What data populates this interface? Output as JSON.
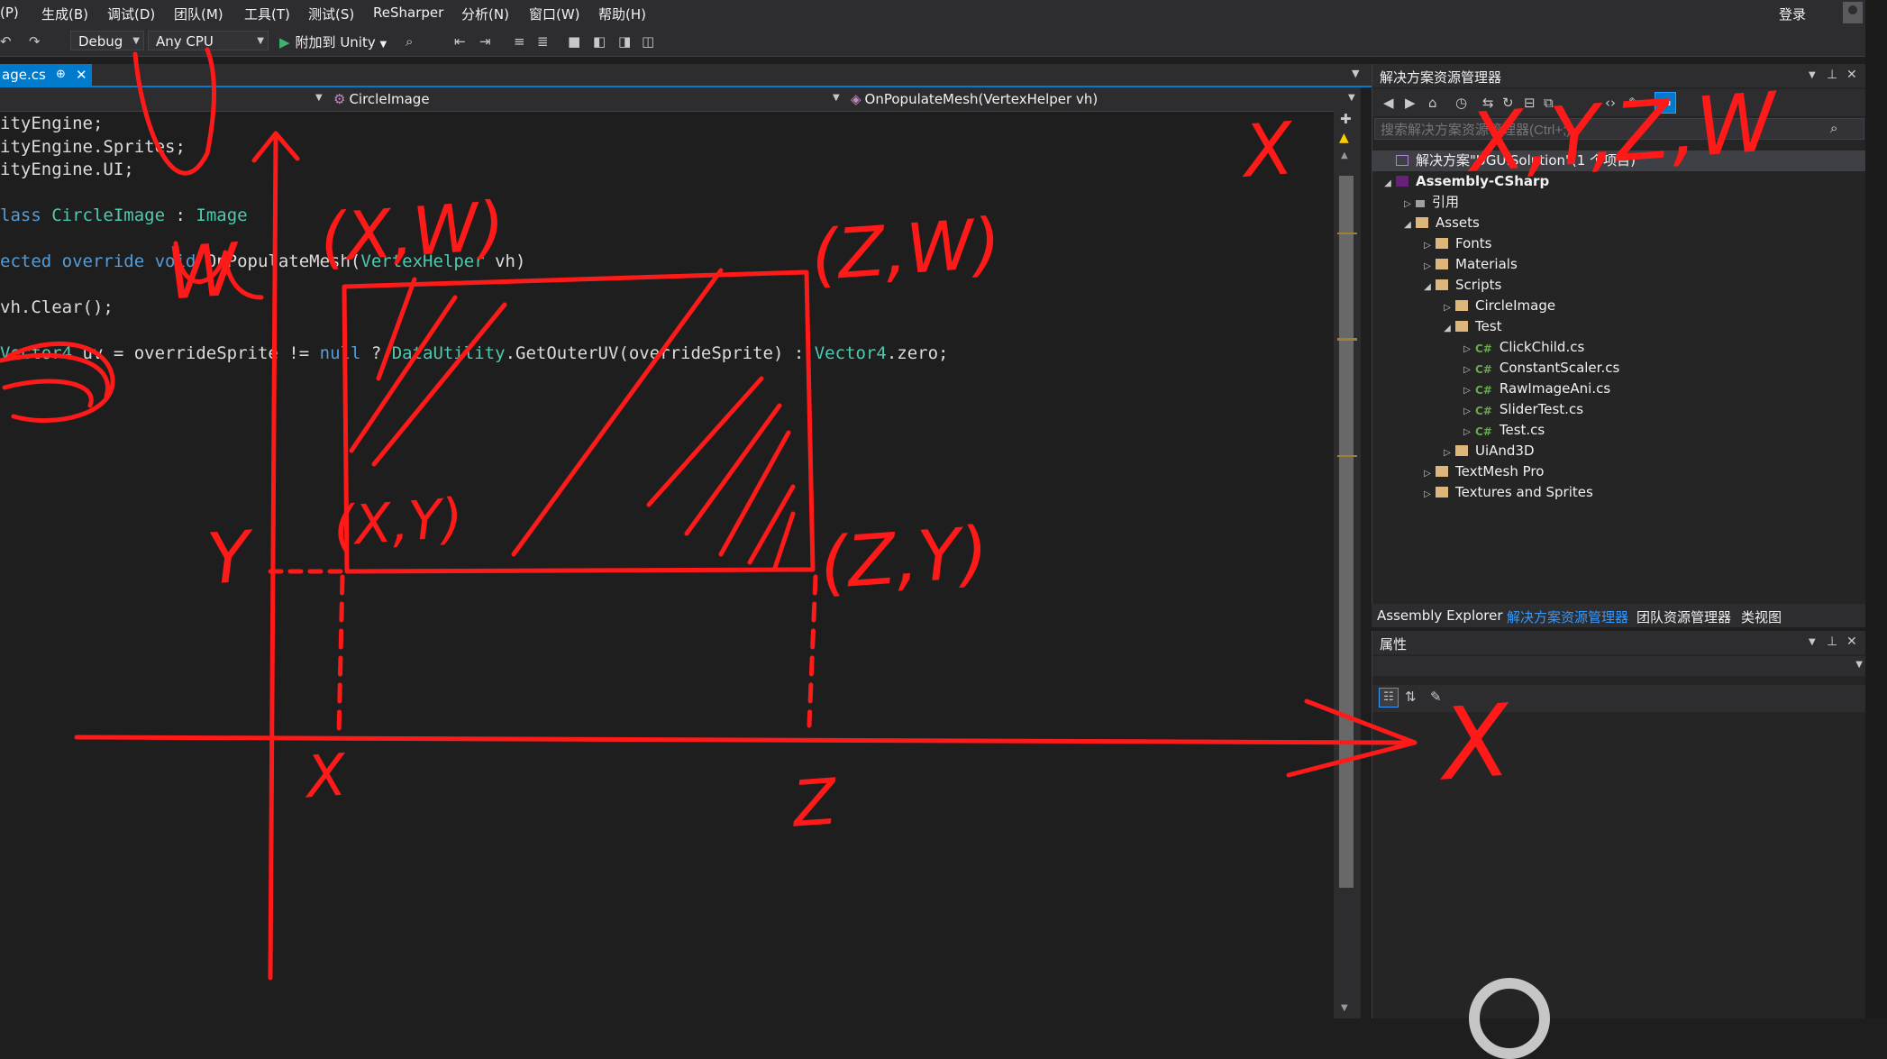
{
  "menu": [
    "(P)",
    "生成(B)",
    "调试(D)",
    "团队(M)",
    "工具(T)",
    "测试(S)",
    "ReSharper",
    "分析(N)",
    "窗口(W)",
    "帮助(H)"
  ],
  "login_label": "登录",
  "toolbar": {
    "config": "Debug",
    "platform": "Any CPU",
    "run_label": "附加到 Unity",
    "icons": [
      "undo-icon",
      "redo-icon",
      "find-icon",
      "comment-icon",
      "bookmark-icon"
    ]
  },
  "editor": {
    "tab_label": "age.cs",
    "tab_pin": "⊕",
    "tab_close": "✕",
    "nav_class": "CircleImage",
    "nav_method": "OnPopulateMesh(VertexHelper vh)"
  },
  "code": {
    "lines": [
      [
        {
          "t": "ityEngine;",
          "c": "tx"
        }
      ],
      [
        {
          "t": "ityEngine.Sprites;",
          "c": "tx"
        }
      ],
      [
        {
          "t": "ityEngine.UI;",
          "c": "tx"
        }
      ],
      [],
      [
        {
          "t": "lass ",
          "c": "kw"
        },
        {
          "t": "CircleImage",
          "c": "ty"
        },
        {
          "t": " : ",
          "c": "tx"
        },
        {
          "t": "Image",
          "c": "ty"
        }
      ],
      [],
      [
        {
          "t": "ected override void ",
          "c": "kw"
        },
        {
          "t": "OnPopulateMesh(",
          "c": "tx"
        },
        {
          "t": "VertexHelper",
          "c": "ty"
        },
        {
          "t": " vh)",
          "c": "tx"
        }
      ],
      [],
      [
        {
          "t": "vh.Clear();",
          "c": "tx"
        }
      ],
      [],
      [
        {
          "t": "Vector4",
          "c": "ty"
        },
        {
          "t": " uv = overrideSprite != ",
          "c": "tx"
        },
        {
          "t": "null",
          "c": "kw"
        },
        {
          "t": " ? ",
          "c": "tx"
        },
        {
          "t": "DataUtility",
          "c": "ty"
        },
        {
          "t": ".GetOuterUV(overrideSprite) : ",
          "c": "tx"
        },
        {
          "t": "Vector4",
          "c": "ty"
        },
        {
          "t": ".zero;",
          "c": "tx"
        }
      ]
    ]
  },
  "solution_explorer": {
    "title": "解决方案资源管理器",
    "search_placeholder": "搜索解决方案资源管理器(Ctrl+;)",
    "tree": [
      {
        "label": "解决方案\"UGUISolution\"(1 个项目)",
        "depth": 0,
        "expander": "",
        "icon": "sol",
        "bold": false
      },
      {
        "label": "Assembly-CSharp",
        "depth": 0,
        "expander": "◢",
        "icon": "proj",
        "bold": true
      },
      {
        "label": "引用",
        "depth": 1,
        "expander": "▷",
        "icon": "ref",
        "bold": false
      },
      {
        "label": "Assets",
        "depth": 1,
        "expander": "◢",
        "icon": "folder",
        "bold": false
      },
      {
        "label": "Fonts",
        "depth": 2,
        "expander": "▷",
        "icon": "folder",
        "bold": false
      },
      {
        "label": "Materials",
        "depth": 2,
        "expander": "▷",
        "icon": "folder",
        "bold": false
      },
      {
        "label": "Scripts",
        "depth": 2,
        "expander": "◢",
        "icon": "folder",
        "bold": false
      },
      {
        "label": "CircleImage",
        "depth": 3,
        "expander": "▷",
        "icon": "folder",
        "bold": false
      },
      {
        "label": "Test",
        "depth": 3,
        "expander": "◢",
        "icon": "folder",
        "bold": false
      },
      {
        "label": "ClickChild.cs",
        "depth": 4,
        "expander": "▷",
        "icon": "cs",
        "bold": false
      },
      {
        "label": "ConstantScaler.cs",
        "depth": 4,
        "expander": "▷",
        "icon": "cs",
        "bold": false
      },
      {
        "label": "RawImageAni.cs",
        "depth": 4,
        "expander": "▷",
        "icon": "cs",
        "bold": false
      },
      {
        "label": "SliderTest.cs",
        "depth": 4,
        "expander": "▷",
        "icon": "cs",
        "bold": false
      },
      {
        "label": "Test.cs",
        "depth": 4,
        "expander": "▷",
        "icon": "cs",
        "bold": false
      },
      {
        "label": "UiAnd3D",
        "depth": 3,
        "expander": "▷",
        "icon": "folder",
        "bold": false
      },
      {
        "label": "TextMesh Pro",
        "depth": 2,
        "expander": "▷",
        "icon": "folder",
        "bold": false
      },
      {
        "label": "Textures and Sprites",
        "depth": 2,
        "expander": "▷",
        "icon": "folder",
        "bold": false
      }
    ],
    "cs_badge": "C#"
  },
  "bottom_tabs": [
    "Assembly Explorer",
    "解决方案资源管理器",
    "团队资源管理器",
    "类视图"
  ],
  "bottom_tab_active": 1,
  "properties": {
    "title": "属性"
  },
  "annotations": {
    "color": "#ff1a1a",
    "labels": [
      "(X,W)",
      "(Z,W)",
      "(X,Y)",
      "(Z,Y)",
      "X",
      "Z",
      "Y",
      "W",
      "X",
      "X,Y,Z,W",
      "X"
    ]
  }
}
